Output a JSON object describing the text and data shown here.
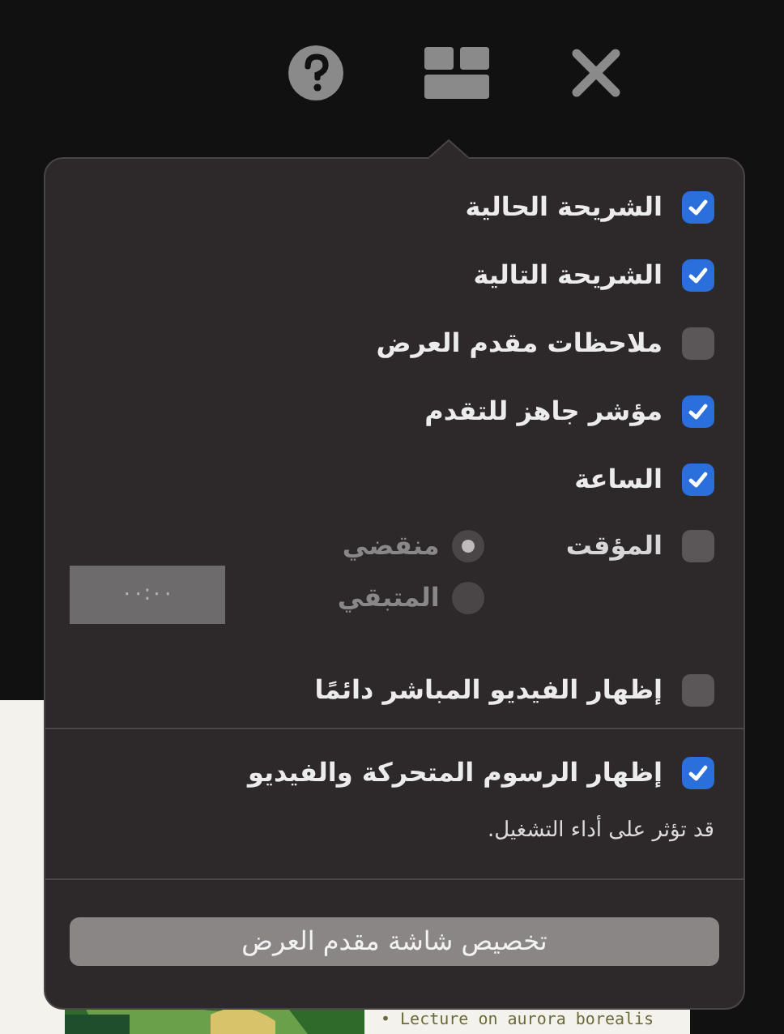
{
  "options": [
    {
      "kind": "checkbox",
      "label": "الشريحة الحالية",
      "checked": true
    },
    {
      "kind": "checkbox",
      "label": "الشريحة التالية",
      "checked": true
    },
    {
      "kind": "checkbox",
      "label": "ملاحظات مقدم العرض",
      "checked": false
    },
    {
      "kind": "checkbox",
      "label": "مؤشر جاهز للتقدم",
      "checked": true
    },
    {
      "kind": "checkbox",
      "label": "الساعة",
      "checked": true
    },
    {
      "kind": "timer",
      "label": "المؤقت",
      "checked": false,
      "disabled": true,
      "radios": [
        {
          "label": "منقضي",
          "selected": true
        },
        {
          "label": "المتبقي",
          "selected": false
        }
      ],
      "value": "٠٠:٠٠"
    }
  ],
  "live_video": {
    "label": "إظهار الفيديو المباشر دائمًا",
    "checked": false
  },
  "animations": {
    "label": "إظهار الرسوم المتحركة والفيديو",
    "checked": true,
    "note": "قد تؤثر على أداء التشغيل."
  },
  "customize_button": "تخصيص شاشة مقدم العرض",
  "background_slide": {
    "text": "• Lecture on aurora borealis"
  }
}
